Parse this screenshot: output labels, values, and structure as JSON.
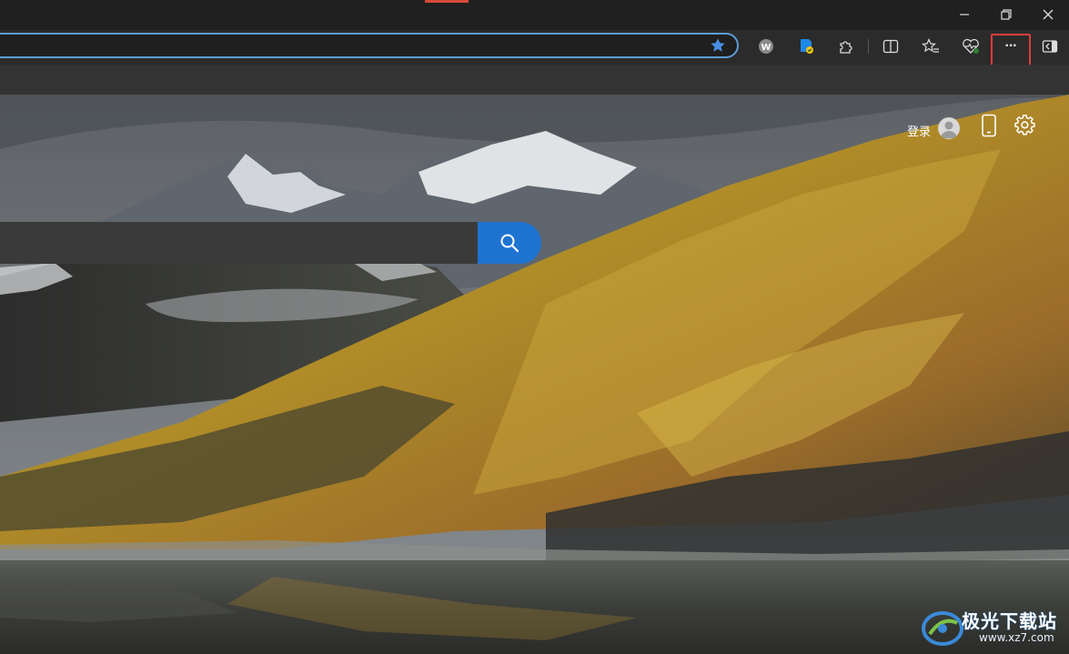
{
  "window": {
    "minimize_icon": "minimize-icon",
    "restore_icon": "restore-icon",
    "close_icon": "close-icon"
  },
  "toolbar": {
    "address_value": "",
    "favorite_icon": "star-filled-icon",
    "extensions": [
      "wps-icon",
      "edge-shield-icon",
      "puzzle-extensions-icon"
    ],
    "actions": [
      "split-screen-icon",
      "favorites-icon",
      "browser-essentials-icon",
      "more-dots-icon",
      "sidebar-icon"
    ],
    "more_label": "···",
    "accent_color": "#5b9bd5",
    "highlight_color": "#e23b3b"
  },
  "page": {
    "signin_label": "登录",
    "search_value": "",
    "search_button_color": "#1f73d1"
  },
  "watermark": {
    "brand": "极光下载站",
    "url": "www.xz7.com"
  }
}
